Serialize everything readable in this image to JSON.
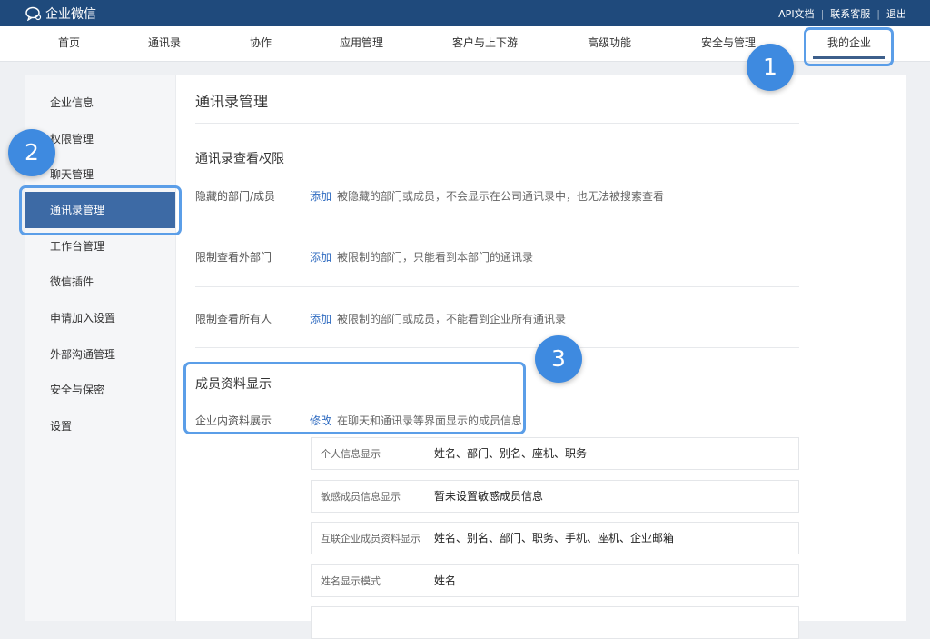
{
  "topbar": {
    "brand": "企业微信",
    "links": [
      "API文档",
      "联系客服",
      "退出"
    ]
  },
  "nav": {
    "items": [
      "首页",
      "通讯录",
      "协作",
      "应用管理",
      "客户与上下游",
      "高级功能",
      "安全与管理",
      "我的企业"
    ],
    "active_index": 7
  },
  "sidebar": {
    "items": [
      "企业信息",
      "权限管理",
      "聊天管理",
      "通讯录管理",
      "工作台管理",
      "微信插件",
      "申请加入设置",
      "外部沟通管理",
      "安全与保密",
      "设置"
    ],
    "active_index": 3
  },
  "main": {
    "title": "通讯录管理",
    "view_section": {
      "title": "通讯录查看权限",
      "rows": [
        {
          "label": "隐藏的部门/成员",
          "link": "添加",
          "desc": "被隐藏的部门或成员，不会显示在公司通讯录中，也无法被搜索查看"
        },
        {
          "label": "限制查看外部门",
          "link": "添加",
          "desc": "被限制的部门，只能看到本部门的通讯录"
        },
        {
          "label": "限制查看所有人",
          "link": "添加",
          "desc": "被限制的部门或成员，不能看到企业所有通讯录"
        }
      ]
    },
    "profile_section": {
      "title": "成员资料显示",
      "row": {
        "label": "企业内资料展示",
        "link": "修改",
        "desc": "在聊天和通讯录等界面显示的成员信息"
      },
      "fields": [
        {
          "label": "个人信息显示",
          "value": "姓名、部门、别名、座机、职务"
        },
        {
          "label": "敏感成员信息显示",
          "value": "暂未设置敏感成员信息"
        },
        {
          "label": "互联企业成员资料显示",
          "value": "姓名、别名、部门、职务、手机、座机、企业邮箱"
        },
        {
          "label": "姓名显示模式",
          "value": "姓名"
        },
        {
          "label": "",
          "value": ""
        }
      ]
    }
  },
  "annotations": [
    "1",
    "2",
    "3"
  ],
  "colors": {
    "topbar": "#1f4a7c",
    "sidebar_active": "#3d6aa5",
    "link": "#2f6bc0",
    "highlight": "#5b9ee8",
    "badge": "#3e8ae0"
  }
}
